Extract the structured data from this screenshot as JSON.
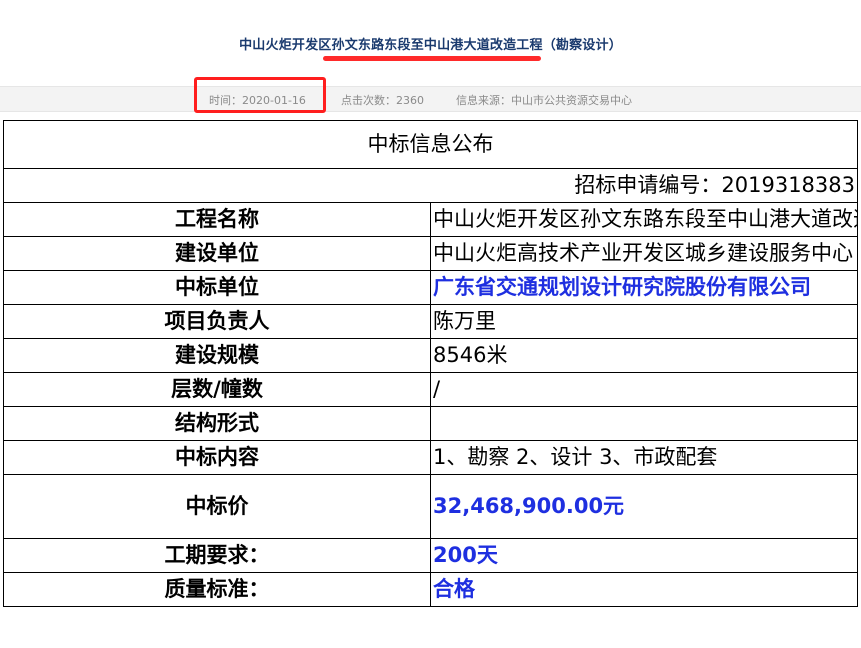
{
  "article": {
    "title": "中山火炬开发区孙文东路东段至中山港大道改造工程（勘察设计）",
    "time": "时间：2020-01-16",
    "clicks": "点击次数：2360",
    "source": "信息来源：中山市公共资源交易中心"
  },
  "notice": {
    "heading": "中标信息公布",
    "application_no": "招标申请编号：2019318383",
    "rows": [
      {
        "label": "工程名称",
        "value": "中山火炬开发区孙文东路东段至中山港大道改造工程（勘察设计）"
      },
      {
        "label": "建设单位",
        "value": "中山火炬高技术产业开发区城乡建设服务中心"
      },
      {
        "label": "中标单位",
        "value": "广东省交通规划设计研究院股份有限公司"
      },
      {
        "label": "项目负责人",
        "value": "陈万里"
      },
      {
        "label": "建设规模",
        "value": "8546米"
      },
      {
        "label": "层数/幢数",
        "value": "/"
      },
      {
        "label": "结构形式",
        "value": ""
      },
      {
        "label": "中标内容",
        "value": "1、勘察 2、设计 3、市政配套"
      },
      {
        "label": "中标价",
        "value": "32,468,900.00元"
      },
      {
        "label": "工期要求：",
        "value": "200天"
      },
      {
        "label": "质量标准：",
        "value": "合格"
      }
    ]
  },
  "colors": {
    "title": "#1a3a6e",
    "highlight": "#ff1e1e",
    "emphasis": "#1e2fe0",
    "meta_text": "#8a8a8a"
  }
}
